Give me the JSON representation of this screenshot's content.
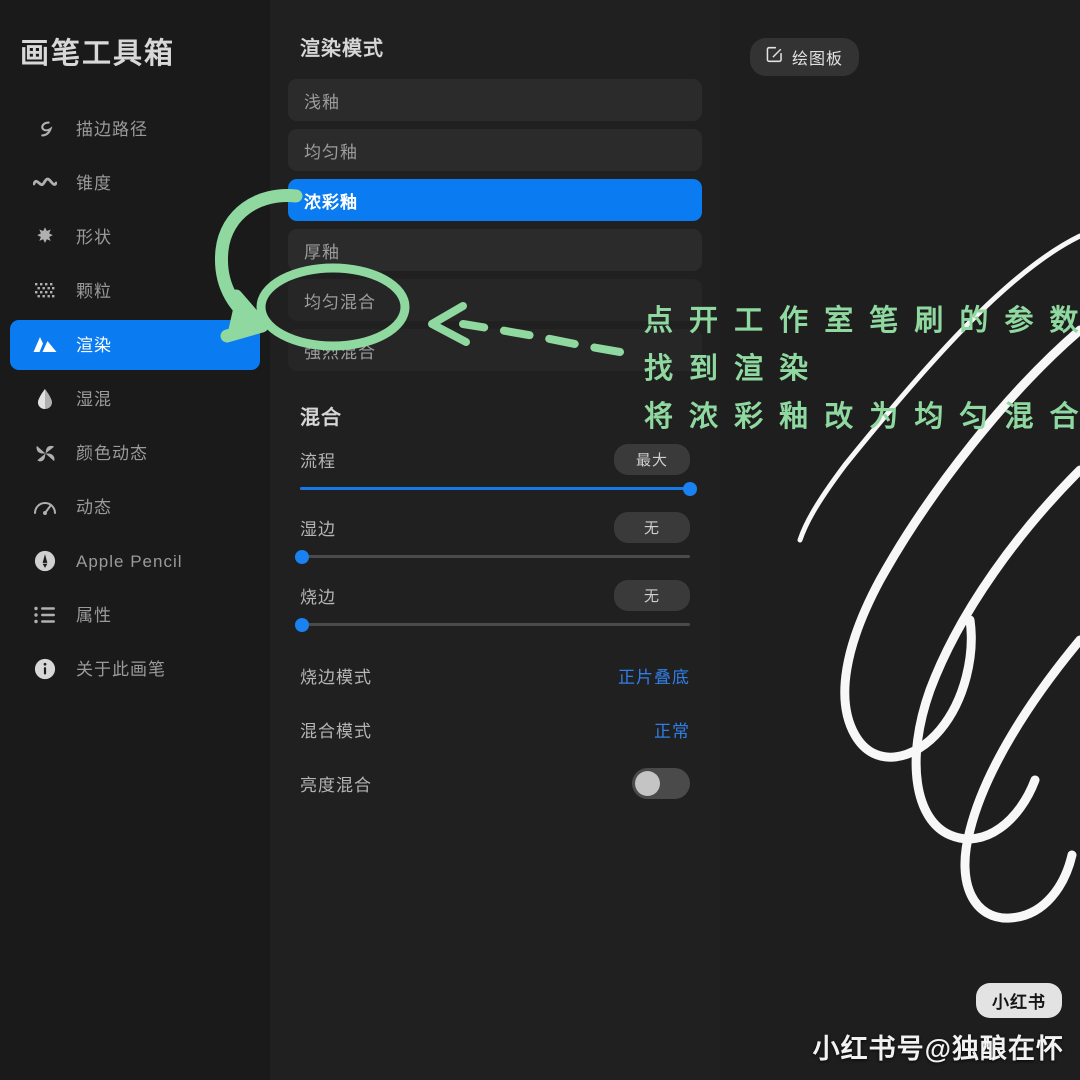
{
  "sidebar": {
    "title": "画笔工具箱",
    "items": [
      {
        "label": "描边路径",
        "icon": "stroke-path-icon",
        "active": false
      },
      {
        "label": "锥度",
        "icon": "taper-wave-icon",
        "active": false
      },
      {
        "label": "形状",
        "icon": "shape-star-icon",
        "active": false
      },
      {
        "label": "颗粒",
        "icon": "grain-dots-icon",
        "active": false
      },
      {
        "label": "渲染",
        "icon": "render-mountain-icon",
        "active": true
      },
      {
        "label": "湿混",
        "icon": "wet-mix-droplet-icon",
        "active": false
      },
      {
        "label": "颜色动态",
        "icon": "color-dynamics-icon",
        "active": false
      },
      {
        "label": "动态",
        "icon": "dynamics-gauge-icon",
        "active": false
      },
      {
        "label": "Apple Pencil",
        "icon": "apple-pencil-icon",
        "active": false
      },
      {
        "label": "属性",
        "icon": "properties-list-icon",
        "active": false
      },
      {
        "label": "关于此画笔",
        "icon": "info-circle-icon",
        "active": false
      }
    ]
  },
  "panel": {
    "render_mode_heading": "渲染模式",
    "render_modes": [
      {
        "label": "浅釉",
        "selected": false
      },
      {
        "label": "均匀釉",
        "selected": false
      },
      {
        "label": "浓彩釉",
        "selected": true
      },
      {
        "label": "厚釉",
        "selected": false
      },
      {
        "label": "均匀混合",
        "selected": false
      },
      {
        "label": "强烈混合",
        "selected": false
      }
    ],
    "blend_heading": "混合",
    "sliders": [
      {
        "label": "流程",
        "value_label": "最大",
        "percent": 100
      },
      {
        "label": "湿边",
        "value_label": "无",
        "percent": 0
      },
      {
        "label": "烧边",
        "value_label": "无",
        "percent": 0
      }
    ],
    "rows": [
      {
        "key": "烧边模式",
        "value": "正片叠底"
      },
      {
        "key": "混合模式",
        "value": "正常"
      }
    ],
    "toggle_row": {
      "key": "亮度混合",
      "on": false
    }
  },
  "canvas": {
    "draw_button": {
      "label": "绘图板",
      "icon": "edit-square-icon"
    },
    "xhs_badge": "小红书",
    "watermark": "小红书号@独酿在怀"
  },
  "annotations": {
    "lines": [
      "点 开 工 作 室 笔 刷 的 参 数",
      "找 到 渲 染",
      "将 浓 彩 釉 改 为 均 匀 混 合"
    ]
  },
  "colors": {
    "accent_blue": "#0a7bf0",
    "annotation_green": "#8fd9a0",
    "link_blue": "#2f7fe8",
    "sidebar_bg": "#1a1a1a",
    "panel_bg": "#202020",
    "canvas_bg": "#1e1e1e"
  }
}
